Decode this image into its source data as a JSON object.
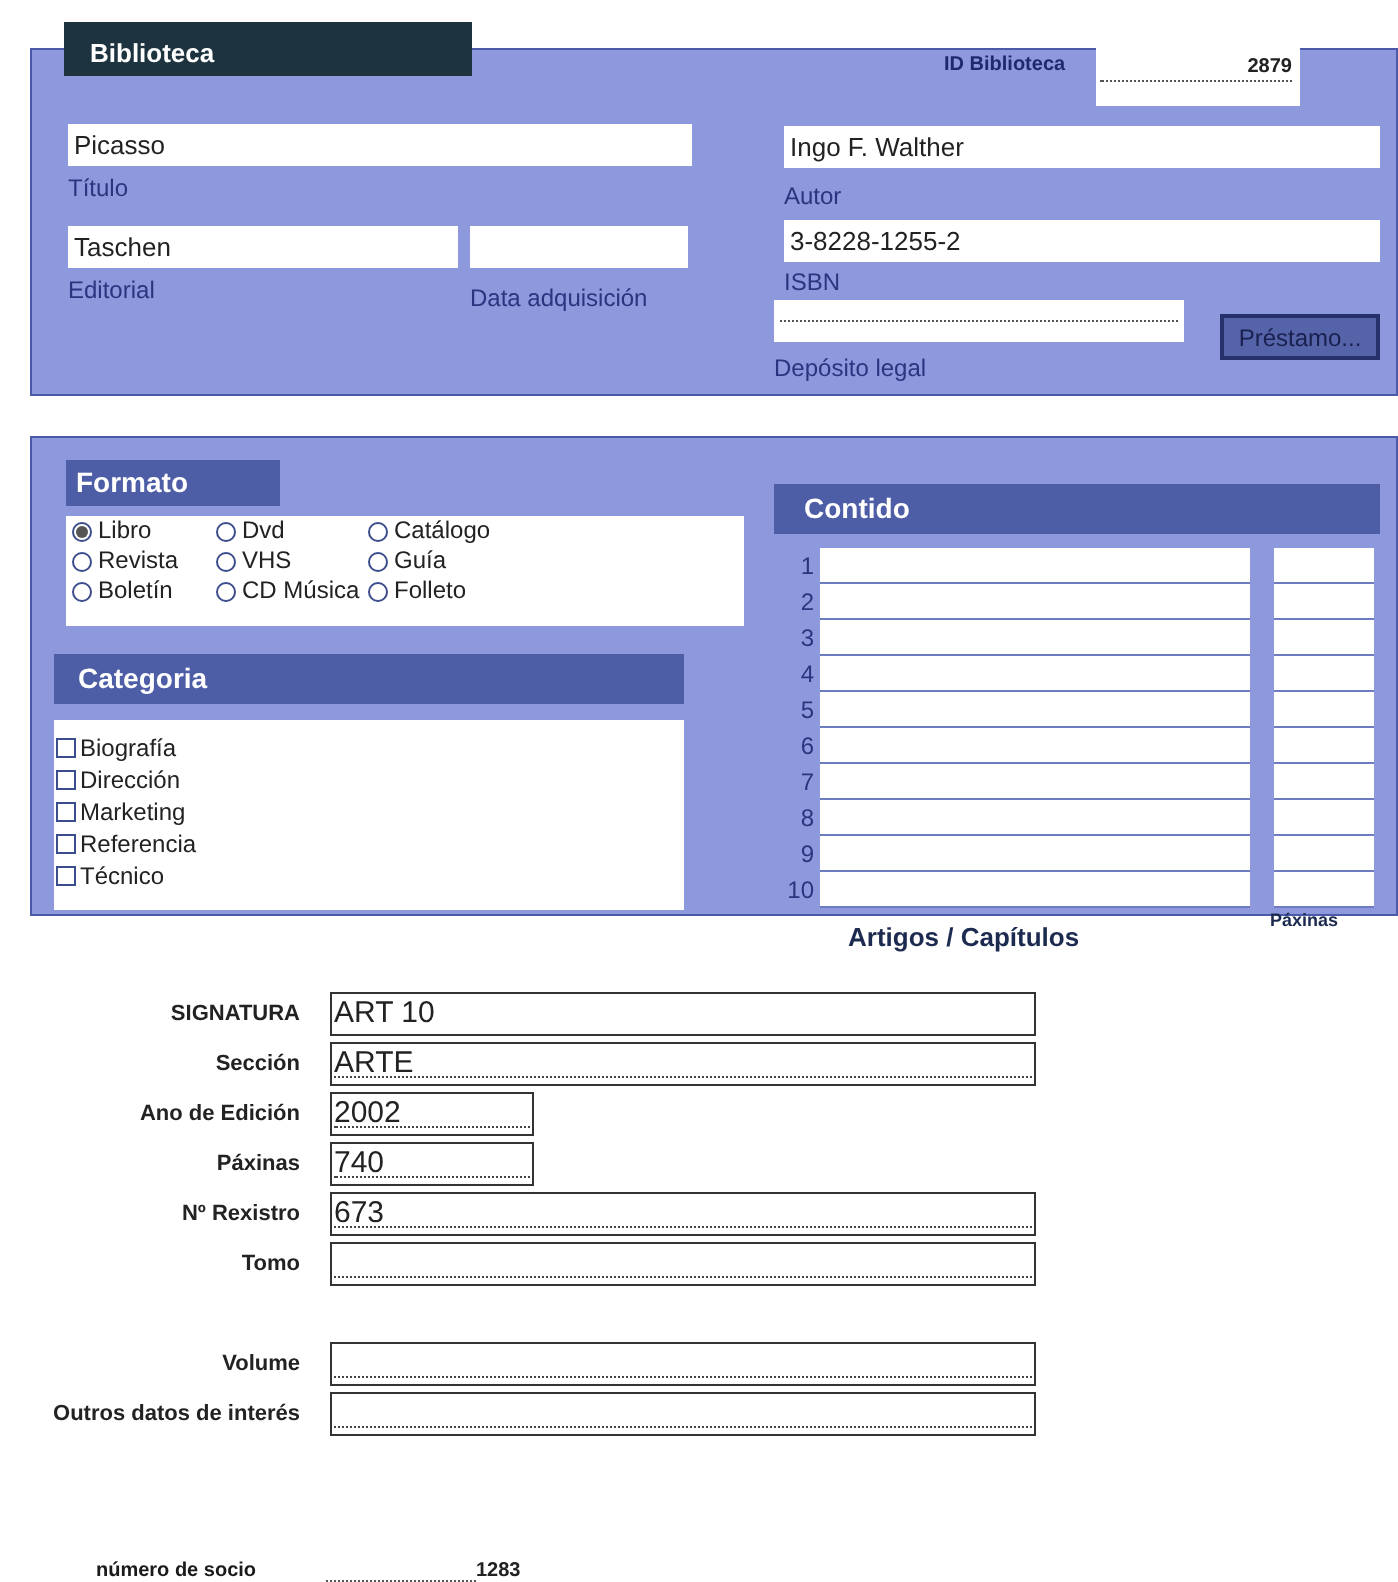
{
  "tab": {
    "label": "Biblioteca"
  },
  "id_field": {
    "label": "ID Biblioteca",
    "value": "2879"
  },
  "top_fields": [
    {
      "label": "Título",
      "value": "Picasso"
    },
    {
      "label": "Autor",
      "value": "Ingo F. Walther"
    },
    {
      "label": "Editorial",
      "value": "Taschen"
    },
    {
      "label": "Data adquisición"
    },
    {
      "label": "ISBN",
      "value": "3-8228-1255-2"
    },
    {
      "label": "Depósito legal"
    }
  ],
  "loan_button": {
    "label": "Préstamo..."
  },
  "formato": {
    "title": "Formato",
    "options": [
      {
        "label": "Libro",
        "selected": true
      },
      {
        "label": "Dvd",
        "selected": false
      },
      {
        "label": "Catálogo",
        "selected": false
      },
      {
        "label": "Revista",
        "selected": false
      },
      {
        "label": "VHS",
        "selected": false
      },
      {
        "label": "Guía",
        "selected": false
      },
      {
        "label": "Boletín",
        "selected": false
      },
      {
        "label": "CD Música",
        "selected": false
      },
      {
        "label": "Folleto",
        "selected": false
      }
    ]
  },
  "categoria": {
    "title": "Categoria",
    "items": [
      {
        "label": "Biografía",
        "checked": false
      },
      {
        "label": "Dirección",
        "checked": false
      },
      {
        "label": "Marketing",
        "checked": false
      },
      {
        "label": "Referencia",
        "checked": false
      },
      {
        "label": "Técnico",
        "checked": false
      }
    ]
  },
  "contido": {
    "title": "Contido",
    "rows": [
      "1",
      "2",
      "3",
      "4",
      "5",
      "6",
      "7",
      "8",
      "9",
      "10"
    ],
    "column_label": "Artigos / Capítulos",
    "pages_label": "Páxinas"
  },
  "details": [
    {
      "label": "SIGNATURA",
      "value": "ART 10"
    },
    {
      "label": "Sección",
      "value": "ARTE"
    },
    {
      "label": "Ano de Edición",
      "value": "2002"
    },
    {
      "label": "Páxinas",
      "value": "740"
    },
    {
      "label": "Nº Rexistro",
      "value": "673"
    },
    {
      "label": "Tomo"
    },
    {
      "label": "Volume"
    },
    {
      "label": "Outros datos de interés"
    }
  ],
  "member": {
    "label": "número de socio",
    "value": "1283"
  }
}
